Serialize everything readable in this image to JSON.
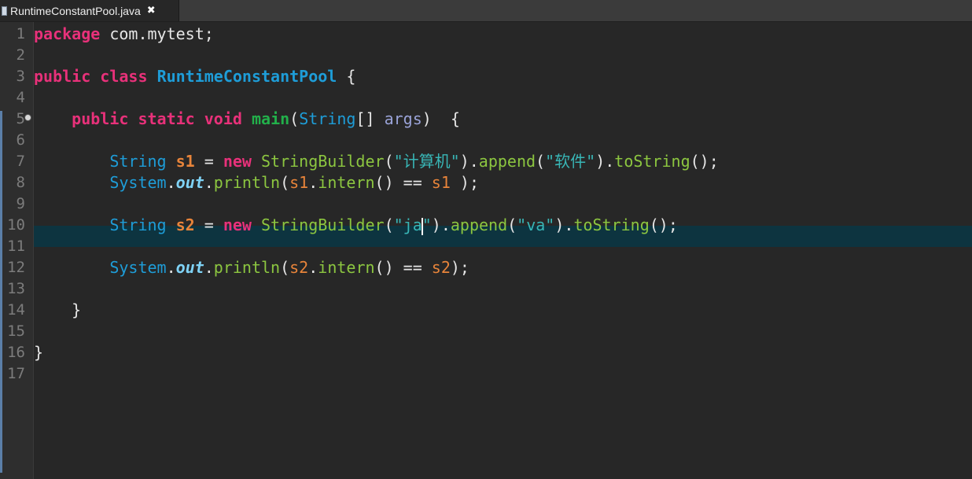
{
  "tab": {
    "label": "RuntimeConstantPool.java",
    "close": "✖",
    "icon": "java-file-icon"
  },
  "editor": {
    "line_numbers": [
      "1",
      "2",
      "3",
      "4",
      "5",
      "6",
      "7",
      "8",
      "9",
      "10",
      "11",
      "12",
      "13",
      "14",
      "15",
      "16",
      "17"
    ],
    "current_line": 10,
    "code": {
      "l1": {
        "kw": "package",
        "rest": " com.mytest;"
      },
      "l3": {
        "kw1": "public",
        "kw2": "class",
        "name": "RuntimeConstantPool",
        "brace": " {"
      },
      "l5": {
        "indent": "    ",
        "kw1": "public",
        "kw2": "static",
        "kw3": "void",
        "name": "main",
        "open": "(",
        "type": "String",
        "arr": "[] ",
        "arg": "args",
        "close": ")  {"
      },
      "l7": {
        "indent": "        ",
        "type": "String",
        "var": "s1",
        "eq": " = ",
        "kw": "new",
        "cls": "StringBuilder",
        "p1": "(",
        "s1": "\"计算机\"",
        "p2": ").",
        "m1": "append",
        "p3": "(",
        "s2": "\"软件\"",
        "p4": ").",
        "m2": "toString",
        "p5": "();"
      },
      "l8": {
        "indent": "        ",
        "type": "System",
        "dot1": ".",
        "field": "out",
        "dot2": ".",
        "m1": "println",
        "p1": "(",
        "v1": "s1",
        "dot3": ".",
        "m2": "intern",
        "p2": "() == ",
        "v2": "s1",
        "p3": " );"
      },
      "l10": {
        "indent": "        ",
        "type": "String",
        "var": "s2",
        "eq": " = ",
        "kw": "new",
        "cls": "StringBuilder",
        "p1": "(",
        "s1a": "\"ja",
        "s1b": "\"",
        "p2": ").",
        "m1": "append",
        "p3": "(",
        "s2": "\"va\"",
        "p4": ").",
        "m2": "toString",
        "p5": "();"
      },
      "l12": {
        "indent": "        ",
        "type": "System",
        "dot1": ".",
        "field": "out",
        "dot2": ".",
        "m1": "println",
        "p1": "(",
        "v1": "s2",
        "dot3": ".",
        "m2": "intern",
        "p2": "() == ",
        "v2": "s2",
        "p3": ");"
      },
      "l14": {
        "text": "    }"
      },
      "l16": {
        "text": "}"
      }
    }
  }
}
